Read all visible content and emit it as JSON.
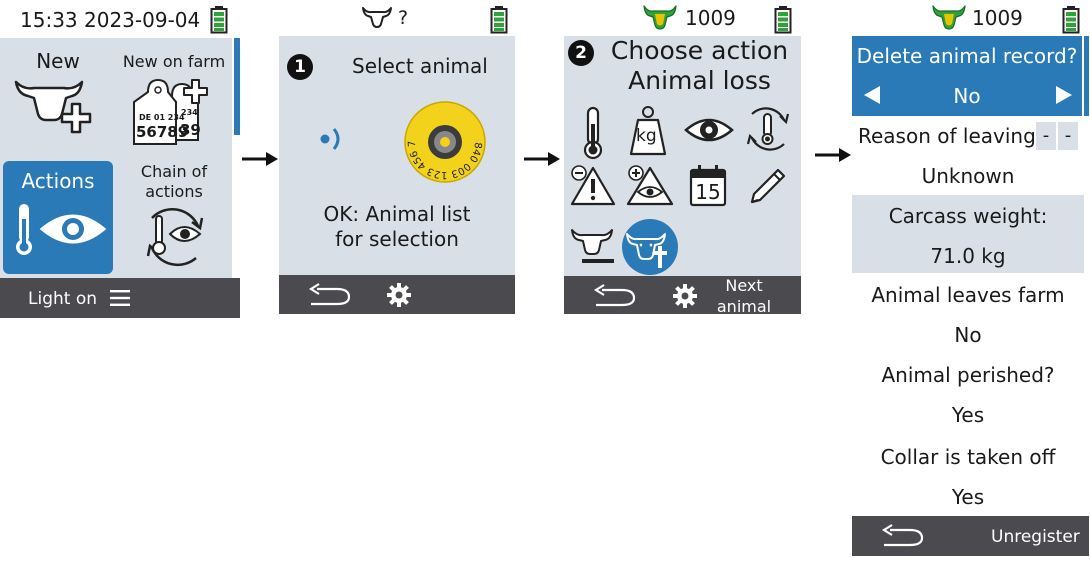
{
  "s1": {
    "time": "15:33",
    "date": "2023-09-04",
    "new_label": "New",
    "new_on_farm_label": "New on farm",
    "ear_tag_text_small": "DE 01 234",
    "ear_tag_text_big": "56789",
    "ear_tag_back_small": "234",
    "ear_tag_back_big": "39",
    "actions_label": "Actions",
    "chain_line1": "Chain of",
    "chain_line2": "actions",
    "light_on": "Light on"
  },
  "s2": {
    "animal_id": "?",
    "step": "1",
    "title": "Select animal",
    "rfid_tag_text": "840 003 123 456 789",
    "ok_line1": "OK: Animal list",
    "ok_line2": "for selection"
  },
  "s3": {
    "animal_id": "1009",
    "step": "2",
    "title_line1": "Choose action",
    "title_line2": "Animal loss",
    "calendar_day": "15",
    "weight_unit": "kg",
    "next_line1": "Next",
    "next_line2": "animal"
  },
  "s4": {
    "animal_id": "1009",
    "delete_question": "Delete animal record?",
    "delete_value": "No",
    "reason_label": "Reason of leaving",
    "reason_dash1": "-",
    "reason_dash2": "-",
    "reason_value": "Unknown",
    "carcass_label": "Carcass weight:",
    "carcass_value": "71.0 kg",
    "leaves_label": "Animal leaves farm",
    "leaves_value": "No",
    "perished_label": "Animal perished?",
    "perished_value": "Yes",
    "collar_label": "Collar is taken off",
    "collar_value": "Yes",
    "unregister": "Unregister"
  },
  "colors": {
    "screen_bg": "#d9dfe6",
    "accent_blue": "#2a7ab8",
    "footer_dark": "#4a4a4f",
    "battery_green": "#2fa33a",
    "cow_green": "#2fa33a",
    "cow_yellow": "#e8c400",
    "tag_yellow": "#f2d21a"
  }
}
